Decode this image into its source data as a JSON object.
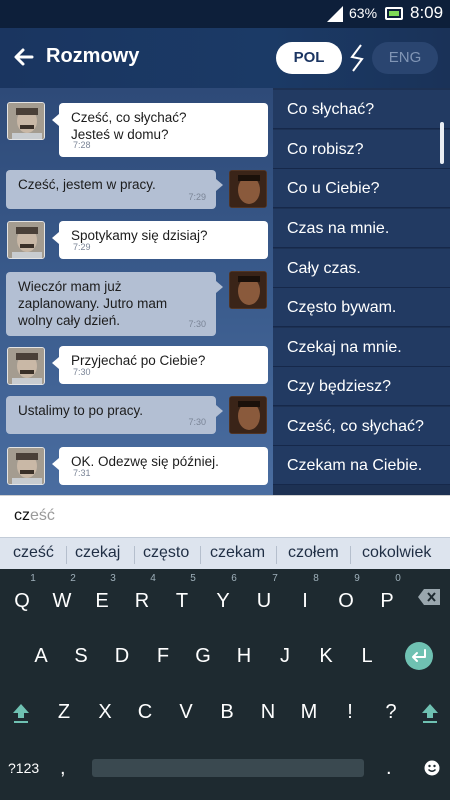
{
  "status_bar": {
    "battery": "63%",
    "time": "8:09"
  },
  "header": {
    "title": "Rozmowy",
    "lang_active": "POL",
    "lang_inactive": "ENG"
  },
  "messages": [
    {
      "side": "in",
      "text_lines": [
        "Cześć, co słychać?",
        "Jesteś w domu?"
      ],
      "time": "7:28"
    },
    {
      "side": "out",
      "text_lines": [
        "Cześć, jestem w pracy."
      ],
      "time": "7:29"
    },
    {
      "side": "in",
      "text_lines": [
        "Spotykamy się dzisiaj?"
      ],
      "time": "7:29"
    },
    {
      "side": "out",
      "text_lines": [
        "Wieczór mam już",
        "zaplanowany. Jutro mam",
        "wolny cały dzień."
      ],
      "time": "7:30"
    },
    {
      "side": "in",
      "text_lines": [
        "Przyjechać po Ciebie?"
      ],
      "time": "7:30"
    },
    {
      "side": "out",
      "text_lines": [
        "Ustalimy to po pracy."
      ],
      "time": "7:30"
    },
    {
      "side": "in",
      "text_lines": [
        "OK. Odezwę się później."
      ],
      "time": "7:31"
    }
  ],
  "phrases": [
    "Co słychać?",
    "Co robisz?",
    "Co u Ciebie?",
    "Czas na mnie.",
    "Cały czas.",
    "Często bywam.",
    "Czekaj na mnie.",
    "Czy będziesz?",
    "Cześć, co słychać?",
    "Czekam na Ciebie."
  ],
  "input": {
    "typed": "cz",
    "completion": "eść"
  },
  "suggestions": [
    "cześć",
    "czekaj",
    "często",
    "czekam",
    "czołem",
    "cokolwiek"
  ],
  "keyboard": {
    "row1": [
      "Q",
      "W",
      "E",
      "R",
      "T",
      "Y",
      "U",
      "I",
      "O",
      "P"
    ],
    "row1_hints": [
      "1",
      "2",
      "3",
      "4",
      "5",
      "6",
      "7",
      "8",
      "9",
      "0"
    ],
    "row2": [
      "A",
      "S",
      "D",
      "F",
      "G",
      "H",
      "J",
      "K",
      "L"
    ],
    "row3": [
      "Z",
      "X",
      "C",
      "V",
      "B",
      "N",
      "M",
      "!",
      "?"
    ],
    "symbols_label": "?123",
    "comma_label": ",",
    "period_label": "."
  },
  "colors": {
    "header_bg": "#1b3a66",
    "accent_enter": "#6fc1b2",
    "keyboard_bg": "#1e2a30"
  }
}
